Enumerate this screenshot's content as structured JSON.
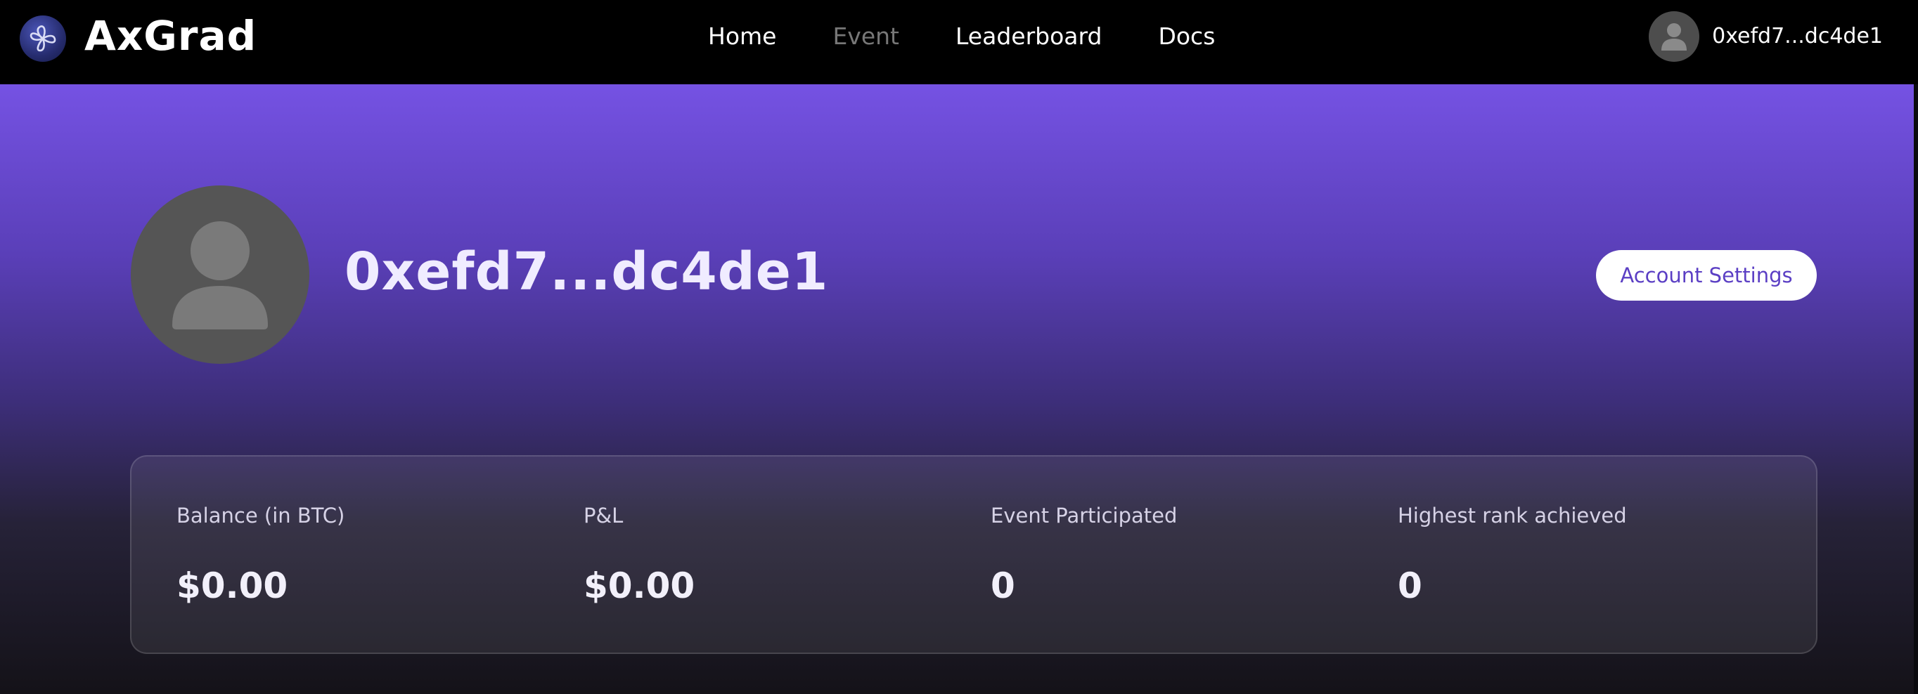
{
  "nav": {
    "brand": "AxGrad",
    "links": [
      {
        "label": "Home",
        "active": true
      },
      {
        "label": "Event",
        "active": false
      },
      {
        "label": "Leaderboard",
        "active": true
      },
      {
        "label": "Docs",
        "active": true
      }
    ],
    "user_address": "0xefd7...dc4de1"
  },
  "profile": {
    "address": "0xefd7...dc4de1",
    "settings_label": "Account Settings"
  },
  "stats": [
    {
      "label": "Balance (in BTC)",
      "value": "$0.00"
    },
    {
      "label": "P&L",
      "value": "$0.00"
    },
    {
      "label": "Event Participated",
      "value": "0"
    },
    {
      "label": "Highest rank achieved",
      "value": "0"
    }
  ],
  "colors": {
    "accent": "#7552e3",
    "button_text": "#5b3fc4",
    "avatar": "#555555",
    "nav_bg": "#000000"
  },
  "icons": {
    "logo": "axgrad-logo-icon",
    "user_avatar": "user-silhouette-icon"
  }
}
